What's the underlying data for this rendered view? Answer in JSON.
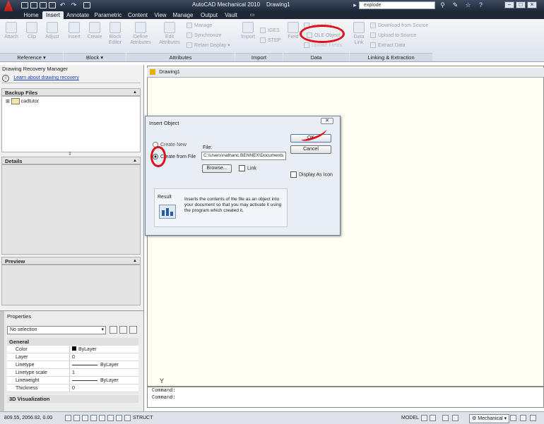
{
  "title_bar": {
    "app_title": "AutoCAD Mechanical 2010",
    "doc_title": "Drawing1",
    "search_value": "explode"
  },
  "tabs": [
    "Home",
    "Insert",
    "Annotate",
    "Parametric",
    "Content",
    "View",
    "Manage",
    "Output",
    "Vault"
  ],
  "ribbon": {
    "reference": {
      "label": "Reference",
      "buttons": [
        "Attach",
        "Clip",
        "Adjust"
      ]
    },
    "block": {
      "label": "Block",
      "buttons": [
        "Insert",
        "Create",
        "Block Editor"
      ]
    },
    "attributes": {
      "label": "Attributes",
      "buttons": [
        "Define Attributes",
        "Edit Attributes"
      ],
      "small": [
        "Manage",
        "Synchronize",
        "Retain Display"
      ]
    },
    "import": {
      "label": "Import",
      "buttons": [
        "Import"
      ],
      "small": [
        "IGES",
        "STEP"
      ]
    },
    "data": {
      "label": "Data",
      "buttons": [
        "Field"
      ],
      "small": [
        "Hyperlink",
        "OLE Object",
        "Update Fields"
      ]
    },
    "linking": {
      "label": "Linking & Extraction",
      "buttons": [
        "Data Link"
      ],
      "small": [
        "Download from Source",
        "Upload to Source",
        "Extract Data"
      ]
    }
  },
  "recovery": {
    "title": "Drawing Recovery Manager",
    "learn_link": "Learn about drawing recovery",
    "backup_files": "Backup Files",
    "tree_item": "cadtutor",
    "details": "Details",
    "preview": "Preview"
  },
  "properties": {
    "title": "Properties",
    "selection": "No selection",
    "general": "General",
    "rows": [
      {
        "key": "Color",
        "value": "ByLayer"
      },
      {
        "key": "Layer",
        "value": "0"
      },
      {
        "key": "Linetype",
        "value": "ByLayer"
      },
      {
        "key": "Linetype scale",
        "value": "1"
      },
      {
        "key": "Lineweight",
        "value": "ByLayer"
      },
      {
        "key": "Thickness",
        "value": "0"
      }
    ],
    "visualization": "3D Visualization"
  },
  "drawing": {
    "tab": "Drawing1",
    "ucs_label": "Y"
  },
  "command_lines": [
    "Command:",
    "Command:"
  ],
  "status": {
    "coords": "809.55, 2056.82, 0.00",
    "struct": "STRUCT",
    "model": "MODEL",
    "workspace": "Mechanical"
  },
  "dialog": {
    "title": "Insert Object",
    "create_new": "Create New",
    "create_from_file": "Create from File",
    "file_label": "File:",
    "file_value": "C:\\Users\\nathanc.BENNEX\\Documents",
    "browse": "Browse...",
    "link": "Link",
    "ok": "OK",
    "cancel": "Cancel",
    "display_as_icon": "Display As Icon",
    "result_label": "Result",
    "result_text": "Inserts the contents of the file as an object into your document so that you may activate it using the program which created it."
  },
  "colors": {
    "annotation_red": "#e0101a",
    "accent_blue": "#2a5aa8"
  }
}
